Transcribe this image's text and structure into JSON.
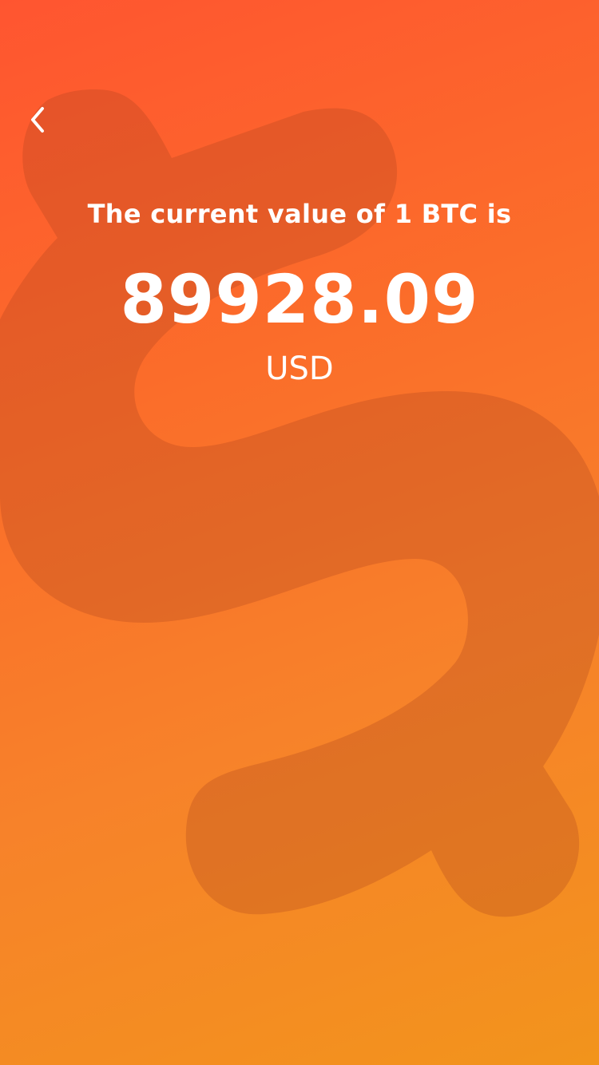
{
  "screen": {
    "colors": {
      "gradient_start": "#ff5530",
      "gradient_end": "#f2941c",
      "text": "#ffffff"
    }
  },
  "nav": {
    "back_icon": "chevron-left-icon"
  },
  "rate": {
    "heading": "The current value of 1 BTC is",
    "value": "89928.09",
    "currency": "USD"
  },
  "background": {
    "icon": "dollar-sign-icon"
  }
}
